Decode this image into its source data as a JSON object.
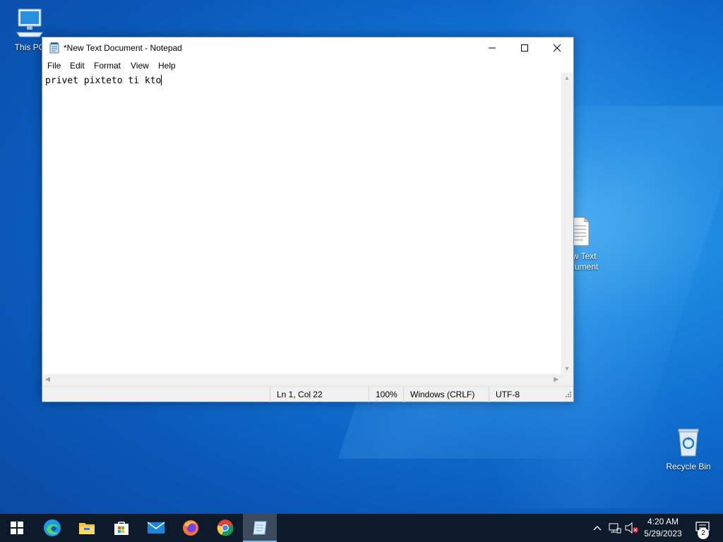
{
  "desktop": {
    "icons": [
      {
        "label": "This PC"
      },
      {
        "label": "New Text Document"
      },
      {
        "label": "Recycle Bin"
      }
    ]
  },
  "notepad": {
    "title": "*New Text Document - Notepad",
    "menu": [
      "File",
      "Edit",
      "Format",
      "View",
      "Help"
    ],
    "content": "privet pixteto ti kto",
    "status": {
      "position": "Ln 1, Col 22",
      "zoom": "100%",
      "line_ending": "Windows (CRLF)",
      "encoding": "UTF-8"
    }
  },
  "taskbar": {
    "apps": [
      "windows-start-icon",
      "edge-icon",
      "file-explorer-icon",
      "store-icon",
      "mail-icon",
      "firefox-icon",
      "chrome-icon",
      "notepad-icon"
    ],
    "clock_time": "4:20 AM",
    "clock_date": "5/29/2023",
    "notification_count": "2"
  },
  "colors": {
    "taskbar": "#0c1a2c",
    "accent": "#0078d7",
    "desktop": "#0f6ecf"
  }
}
